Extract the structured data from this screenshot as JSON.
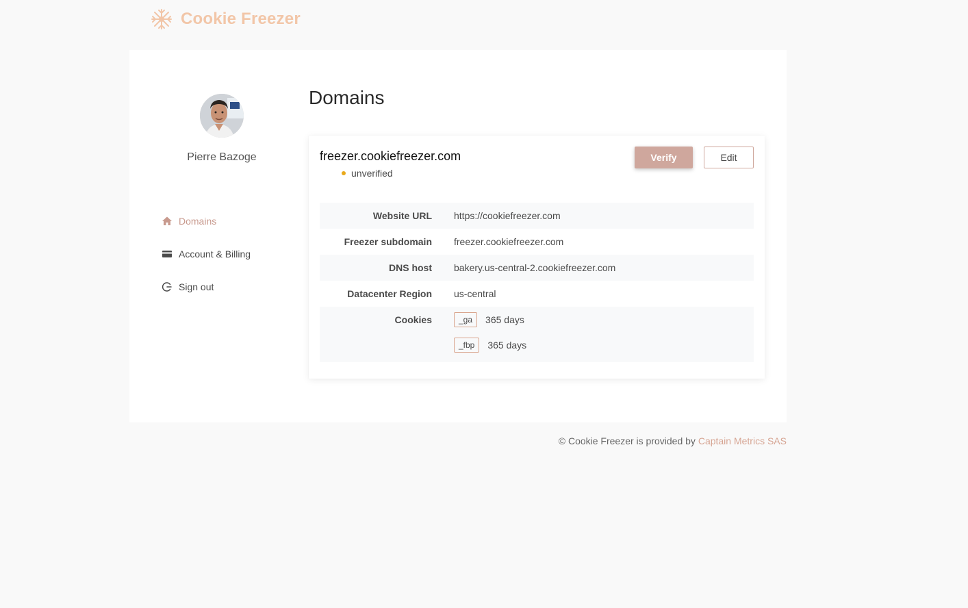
{
  "brand": {
    "name": "Cookie Freezer",
    "logo_icon": "snowflake-icon",
    "color": "#f2c6a8"
  },
  "user": {
    "name": "Pierre Bazoge",
    "avatar": "user-avatar"
  },
  "sidebar": {
    "items": [
      {
        "label": "Domains",
        "icon": "home-icon",
        "active": true
      },
      {
        "label": "Account & Billing",
        "icon": "credit-card-icon",
        "active": false
      },
      {
        "label": "Sign out",
        "icon": "sign-out-icon",
        "active": false
      }
    ]
  },
  "main": {
    "title": "Domains",
    "domain": {
      "name": "freezer.cookiefreezer.com",
      "status": "unverified",
      "status_color": "#e9a91b",
      "verify_label": "Verify",
      "edit_label": "Edit",
      "details": {
        "website_url_label": "Website URL",
        "website_url": "https://cookiefreezer.com",
        "subdomain_label": "Freezer subdomain",
        "subdomain": "freezer.cookiefreezer.com",
        "dns_host_label": "DNS host",
        "dns_host": "bakery.us-central-2.cookiefreezer.com",
        "region_label": "Datacenter Region",
        "region": "us-central",
        "cookies_label": "Cookies",
        "cookies": [
          {
            "name": "_ga",
            "duration": "365 days"
          },
          {
            "name": "_fbp",
            "duration": "365 days"
          }
        ]
      }
    }
  },
  "footer": {
    "text": "© Cookie Freezer is provided by ",
    "link_text": "Captain Metrics SAS"
  },
  "colors": {
    "accent": "#cfa79d",
    "link": "#d6a492",
    "background": "#f9f9f9"
  }
}
